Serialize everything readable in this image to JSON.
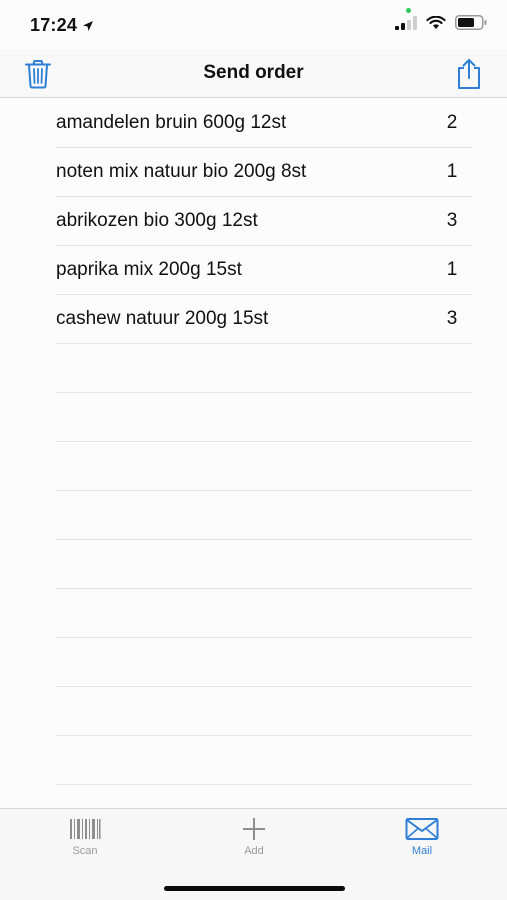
{
  "colors": {
    "accent": "#2f7fd6",
    "inactive": "#9b9b9b",
    "privacy_dot": "#2ecc5a"
  },
  "status_bar": {
    "time": "17:24"
  },
  "nav": {
    "title": "Send order",
    "left_icon": "trash-icon",
    "right_icon": "share-icon"
  },
  "order": {
    "items": [
      {
        "name": "amandelen bruin 600g 12st",
        "qty": "2"
      },
      {
        "name": "noten mix natuur bio 200g 8st",
        "qty": "1"
      },
      {
        "name": "abrikozen bio 300g 12st",
        "qty": "3"
      },
      {
        "name": "paprika mix 200g 15st",
        "qty": "1"
      },
      {
        "name": "cashew natuur 200g 15st",
        "qty": "3"
      }
    ]
  },
  "tabs": [
    {
      "label": "Scan",
      "icon": "barcode-icon",
      "active": false
    },
    {
      "label": "Add",
      "icon": "plus-icon",
      "active": false
    },
    {
      "label": "Mail",
      "icon": "mail-icon",
      "active": true
    }
  ]
}
